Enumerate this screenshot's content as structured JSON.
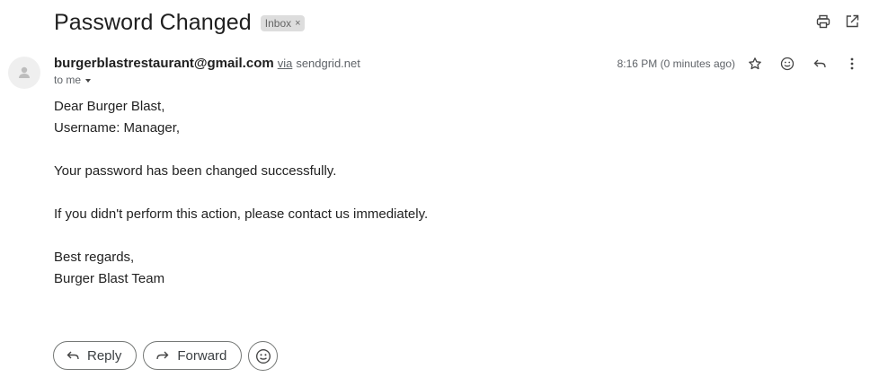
{
  "message": {
    "subject": "Password Changed",
    "label": {
      "text": "Inbox",
      "remove_glyph": "×"
    },
    "sender": {
      "email": "burgerblastrestaurant@gmail.com",
      "via_label": "via",
      "via_domain": "sendgrid.net"
    },
    "recipient_label": "to me",
    "time": "8:16 PM (0 minutes ago)",
    "body_lines": [
      "Dear Burger Blast,",
      "Username: Manager,",
      "",
      "Your password has been changed successfully.",
      "",
      "If you didn't perform this action, please contact us immediately.",
      "",
      "Best regards,",
      "Burger Blast Team"
    ]
  },
  "toolbar": {
    "icons": [
      "print-icon",
      "open-in-new-window-icon"
    ]
  },
  "message_actions": {
    "icons": [
      "star-icon",
      "emoji-reaction-icon",
      "reply-icon",
      "more-vert-icon"
    ]
  },
  "actions": {
    "reply_label": "Reply",
    "forward_label": "Forward"
  },
  "colors": {
    "text_primary": "#1f1f1f",
    "text_secondary": "#5f6368",
    "chip_bg": "#dddddd",
    "button_border": "#747775"
  }
}
